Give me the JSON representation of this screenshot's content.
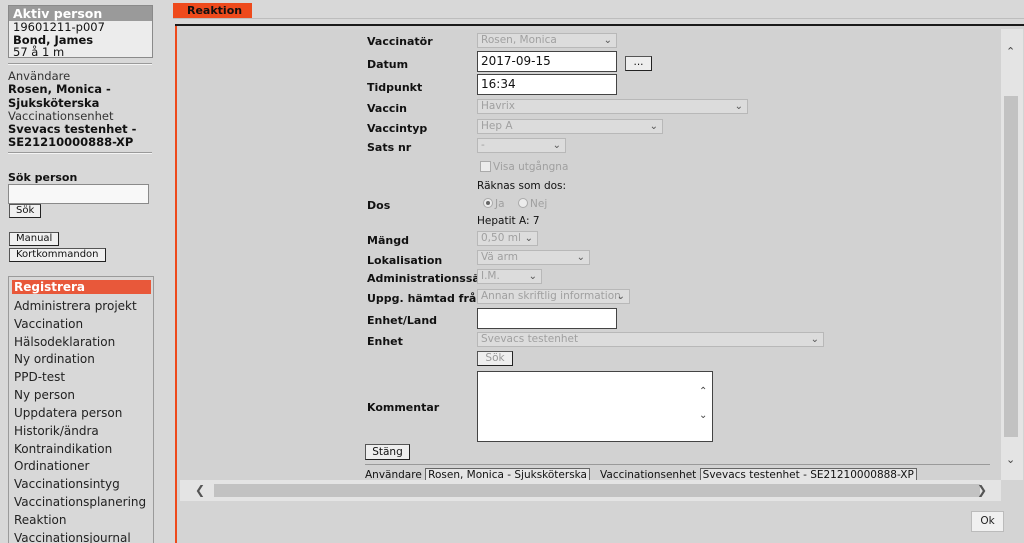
{
  "active_person": {
    "header": "Aktiv person",
    "id": "19601211-p007",
    "name": "Bond, James",
    "age": "57 å 1 m"
  },
  "user": {
    "label": "Användare",
    "name_line1": "Rosen, Monica -",
    "name_line2": "Sjuksköterska",
    "unit_label": "Vaccinationsenhet",
    "unit_line1": "Svevacs testenhet -",
    "unit_line2": "SE21210000888-XP"
  },
  "search": {
    "label": "Sök person",
    "value": "",
    "button": "Sök"
  },
  "buttons": {
    "manual": "Manual",
    "shortcuts": "Kortkommandon"
  },
  "nav": {
    "items": [
      "Registrera",
      "Administrera projekt",
      "Vaccination",
      "Hälsodeklaration",
      "Ny ordination",
      "PPD-test",
      "Ny person",
      "Uppdatera person",
      "Historik/ändra",
      "Kontraindikation",
      "Ordinationer",
      "Vaccinationsintyg",
      "Vaccinationsplanering",
      "Reaktion",
      "Vaccinationsjournal"
    ],
    "active_index": 0
  },
  "tab": {
    "label": "Reaktion"
  },
  "form": {
    "vaccinator": {
      "label": "Vaccinatör",
      "value": "Rosen, Monica"
    },
    "datum": {
      "label": "Datum",
      "value": "2017-09-15",
      "picker": "..."
    },
    "tidpunkt": {
      "label": "Tidpunkt",
      "value": "16:34"
    },
    "vaccin": {
      "label": "Vaccin",
      "value": "Havrix"
    },
    "vaccintyp": {
      "label": "Vaccintyp",
      "value": "Hep A"
    },
    "sats": {
      "label": "Sats nr",
      "value": "-"
    },
    "visa": {
      "label": "Visa utgångna"
    },
    "raknas": {
      "label": "Räknas som dos:"
    },
    "dos": {
      "label": "Dos",
      "yes": "Ja",
      "no": "Nej",
      "info": "Hepatit A: 7"
    },
    "mangd": {
      "label": "Mängd",
      "value": "0,50 ml"
    },
    "lokalisation": {
      "label": "Lokalisation",
      "value": "Vä arm"
    },
    "admin": {
      "label": "Administrationssätt",
      "value": "I.M."
    },
    "uppg": {
      "label": "Uppg. hämtad från",
      "value": "Annan skriftlig information"
    },
    "enhet_land": {
      "label": "Enhet/Land",
      "value": ""
    },
    "enhet": {
      "label": "Enhet",
      "value": "Svevacs testenhet",
      "search_button": "Sök"
    },
    "kommentar": {
      "label": "Kommentar",
      "value": ""
    },
    "close_button": "Stäng"
  },
  "footer": {
    "user_label": "Användare",
    "user_value": "Rosen, Monica - Sjuksköterska",
    "unit_label": "Vaccinationsenhet",
    "unit_value": "Svevacs testenhet - SE21210000888-XP"
  },
  "ok_button": "Ok"
}
